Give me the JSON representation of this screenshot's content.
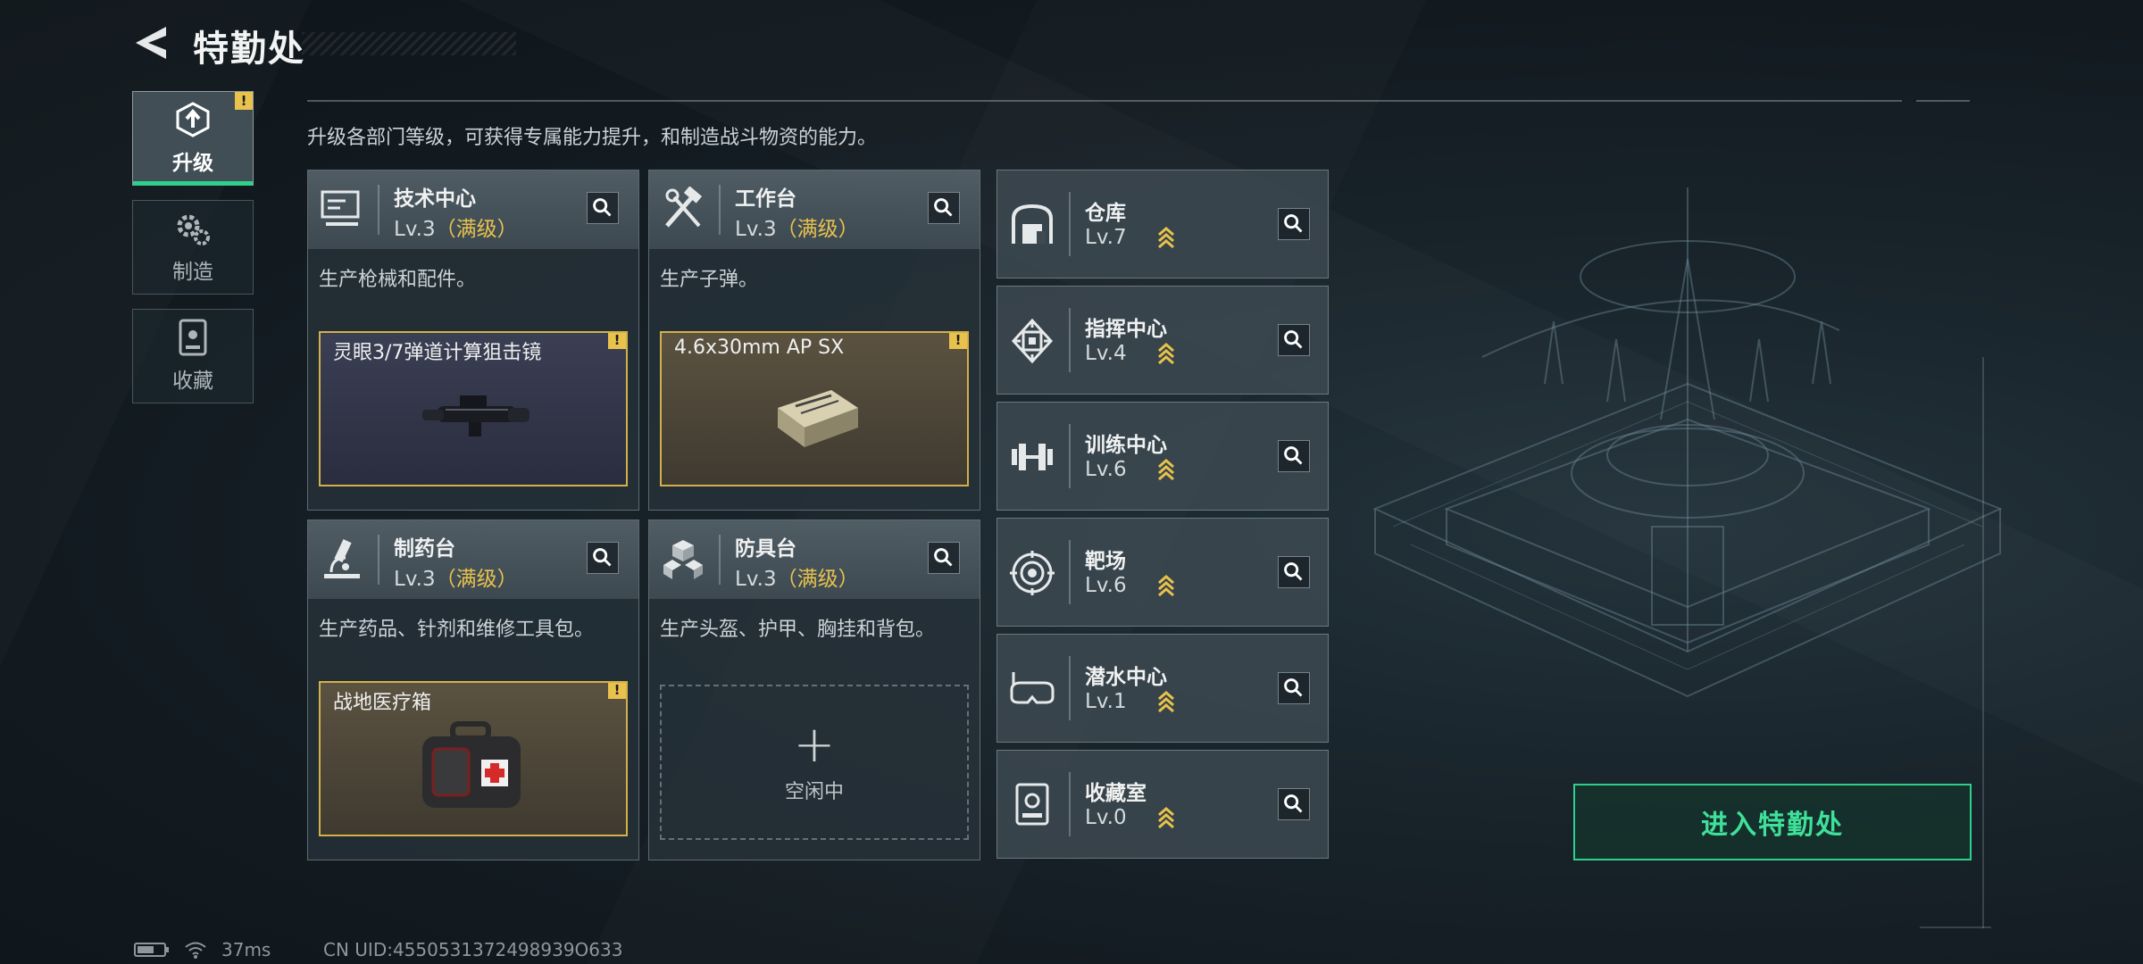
{
  "header": {
    "title": "特勤处"
  },
  "tabs": [
    {
      "label": "升级",
      "active": true,
      "icon": "upgrade-icon",
      "warning": "!"
    },
    {
      "label": "制造",
      "active": false,
      "icon": "gears-icon"
    },
    {
      "label": "收藏",
      "active": false,
      "icon": "collection-icon"
    }
  ],
  "description": "升级各部门等级，可获得专属能力提升，和制造战斗物资的能力。",
  "cards": [
    {
      "name": "技术中心",
      "level": "Lv.3",
      "max": "（满级）",
      "text": "生产枪械和配件。",
      "slot_item": "灵眼3/7弹道计算狙击镜",
      "warning": "!",
      "icon": "computer-icon"
    },
    {
      "name": "工作台",
      "level": "Lv.3",
      "max": "（满级）",
      "text": "生产子弹。",
      "slot_item": "4.6x30mm AP SX",
      "warning": "!",
      "icon": "tools-icon"
    },
    {
      "name": "制药台",
      "level": "Lv.3",
      "max": "（满级）",
      "text": "生产药品、针剂和维修工具包。",
      "slot_item": "战地医疗箱",
      "warning": "!",
      "icon": "microscope-icon"
    },
    {
      "name": "防具台",
      "level": "Lv.3",
      "max": "（满级）",
      "text": "生产头盔、护甲、胸挂和背包。",
      "slot_empty": "空闲中",
      "icon": "armor-boxes-icon"
    }
  ],
  "facilities": [
    {
      "name": "仓库",
      "level": "Lv.7",
      "icon": "warehouse-icon"
    },
    {
      "name": "指挥中心",
      "level": "Lv.4",
      "icon": "chip-icon"
    },
    {
      "name": "训练中心",
      "level": "Lv.6",
      "icon": "dumbbell-icon"
    },
    {
      "name": "靶场",
      "level": "Lv.6",
      "icon": "target-icon"
    },
    {
      "name": "潜水中心",
      "level": "Lv.1",
      "icon": "diving-mask-icon"
    },
    {
      "name": "收藏室",
      "level": "Lv.0",
      "icon": "display-case-icon"
    }
  ],
  "enter_button": "进入特勤处",
  "footer": {
    "ping": "37ms",
    "uid": "CN UID:4550531372498939O633"
  },
  "colors": {
    "accent_green": "#2fd08a",
    "gold": "#e8c24c"
  }
}
